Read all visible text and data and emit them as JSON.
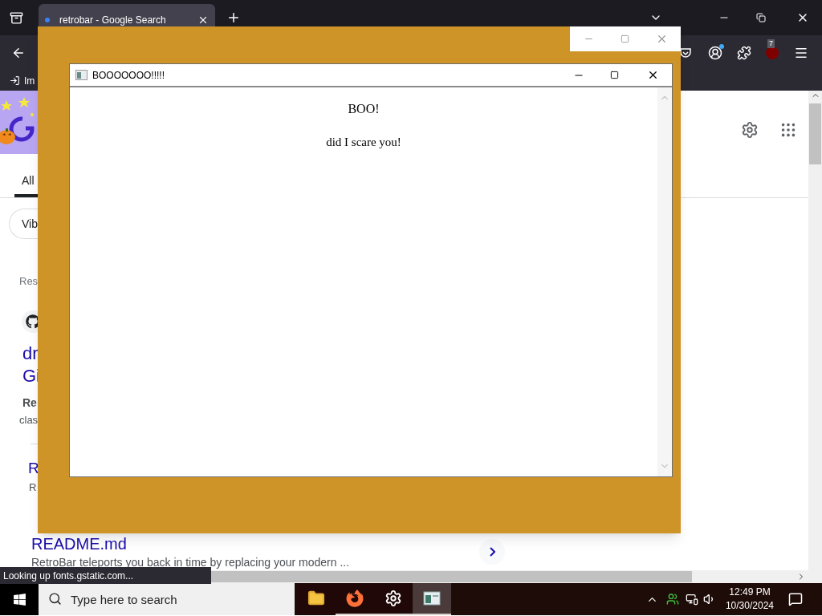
{
  "browser": {
    "tabs": [
      {
        "title": "retrobar - Google Search",
        "selected": true
      }
    ],
    "bookmarks": [
      {
        "label": "Im"
      }
    ],
    "extension_badge": "7",
    "status": "Looking up fonts.gstatic.com..."
  },
  "page": {
    "nav_tabs": [
      {
        "label": "All",
        "selected": true
      }
    ],
    "chips": [
      {
        "label": "Vib"
      }
    ],
    "results_header": "Res",
    "result": {
      "title_lines": [
        "dr",
        "Gi"
      ],
      "snippet_bold": "Re",
      "snippet": "clas"
    },
    "sublinks": [
      {
        "title": "R",
        "snippet": "R"
      },
      {
        "title": "README.md",
        "snippet": "RetroBar teleports you back in time by replacing your modern ..."
      }
    ]
  },
  "dialog": {
    "title": "BOOOOOOO!!!!!",
    "heading": "BOO!",
    "message": "did I scare you!"
  },
  "taskbar": {
    "search_placeholder": "Type here to search",
    "apps": [
      {
        "kind": "folder",
        "running": false,
        "selected": false
      },
      {
        "kind": "firefox",
        "running": true,
        "selected": false
      },
      {
        "kind": "settings",
        "running": true,
        "selected": false
      },
      {
        "kind": "window",
        "running": true,
        "selected": true
      }
    ],
    "time": "12:49 PM",
    "date": "10/30/2024"
  }
}
